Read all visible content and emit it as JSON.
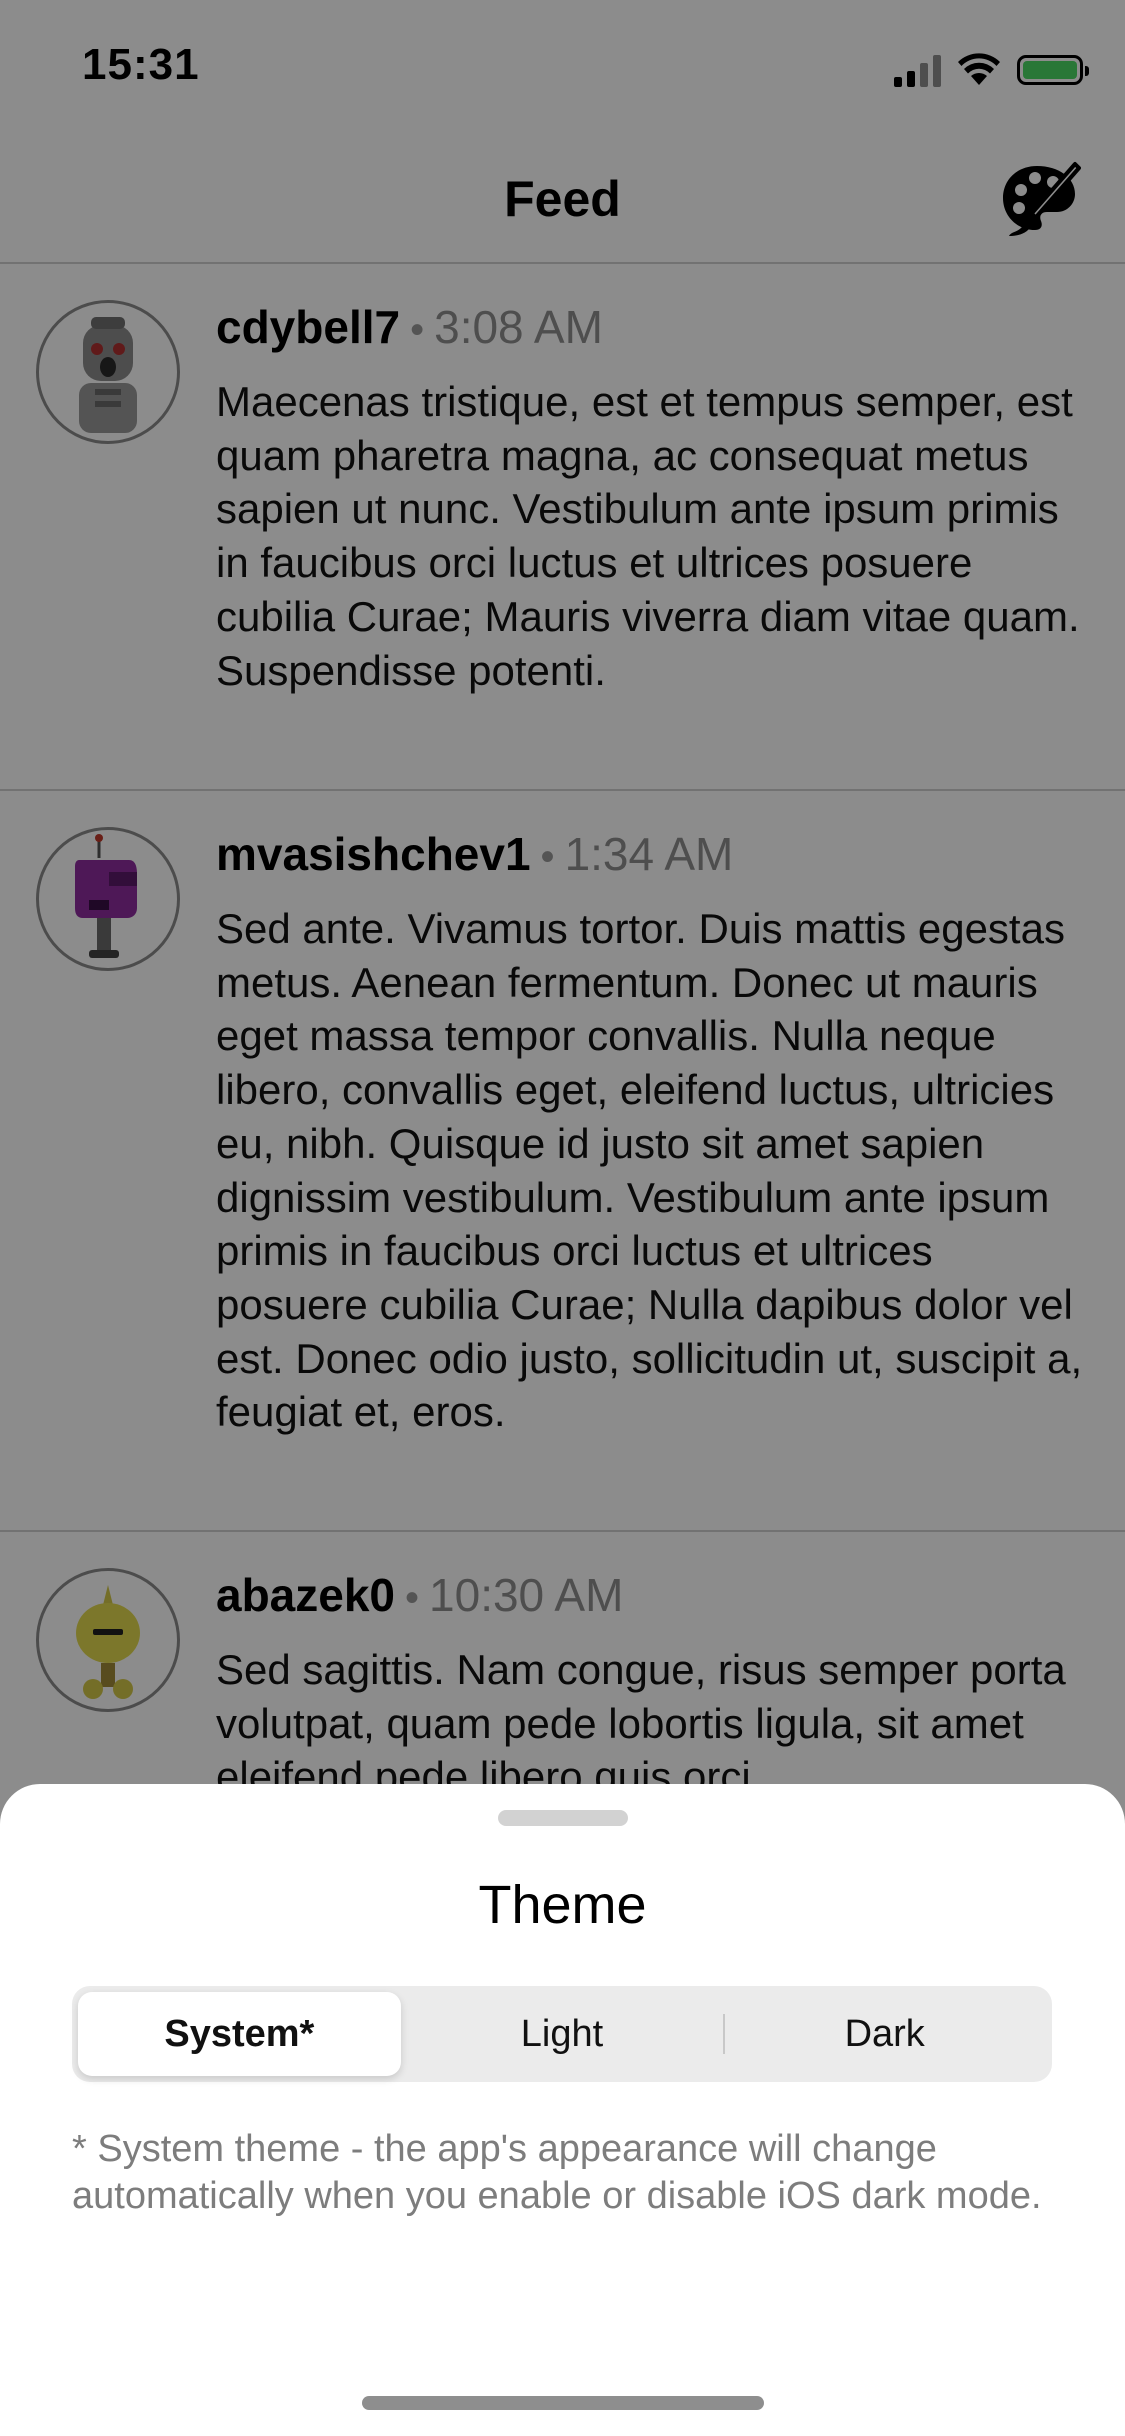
{
  "status_bar": {
    "time": "15:31",
    "battery_color": "#4cd964"
  },
  "nav": {
    "title": "Feed",
    "theme_icon": "palette-brush-icon"
  },
  "posts": [
    {
      "username": "cdybell7",
      "separator": "•",
      "time": "3:08 AM",
      "avatar_icon": "robot-avatar-gray-icon",
      "text": "Maecenas tristique, est et tempus semper, est quam pharetra magna, ac consequat metus sapien ut nunc. Vestibulum ante ipsum primis in faucibus orci luctus et ultrices posuere cubilia Curae; Mauris viverra diam vitae quam. Suspendisse potenti."
    },
    {
      "username": "mvasishchev1",
      "separator": "•",
      "time": "1:34 AM",
      "avatar_icon": "robot-avatar-purple-icon",
      "text": "Sed ante. Vivamus tortor. Duis mattis egestas metus. Aenean fermentum. Donec ut mauris eget massa tempor convallis. Nulla neque libero, convallis eget, eleifend luctus, ultricies eu, nibh. Quisque id justo sit amet sapien dignissim vestibulum. Vestibulum ante ipsum primis in faucibus orci luctus et ultrices posuere cubilia Curae; Nulla dapibus dolor vel est. Donec odio justo, sollicitudin ut, suscipit a, feugiat et, eros."
    },
    {
      "username": "abazek0",
      "separator": "•",
      "time": "10:30 AM",
      "avatar_icon": "robot-avatar-yellow-icon",
      "text": "Sed sagittis. Nam congue, risus semper porta volutpat, quam pede lobortis ligula, sit amet eleifend pede libero quis orci."
    }
  ],
  "sheet": {
    "title": "Theme",
    "options": [
      "System*",
      "Light",
      "Dark"
    ],
    "selected": "System*",
    "note": "* System theme - the app's appearance will change automatically when you enable or disable iOS dark mode."
  }
}
